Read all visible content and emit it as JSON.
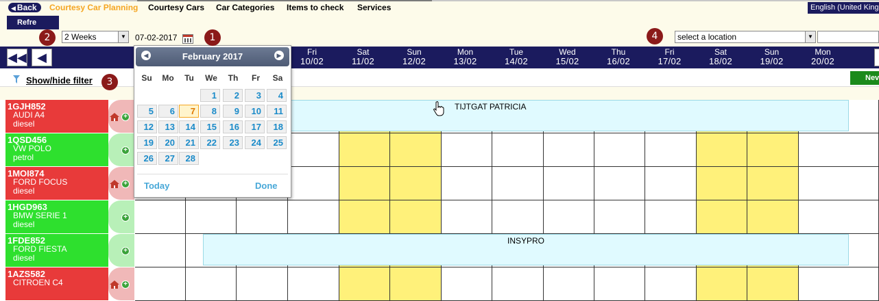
{
  "nav": {
    "back_label": "Back",
    "items": [
      "Courtesy Car Planning",
      "Courtesy Cars",
      "Car Categories",
      "Items to check",
      "Services"
    ],
    "language": "English (United Kingdom)"
  },
  "toolbar": {
    "refresh_label": "Refre",
    "period_value": "2 Weeks",
    "date_value": "07-02-2017",
    "location_placeholder": "select a location"
  },
  "markers": [
    "1",
    "2",
    "3",
    "4"
  ],
  "filter": {
    "label": "Show/hide filter",
    "new_label": "Nev"
  },
  "days": [
    {
      "name": "Fri",
      "date": "10/02"
    },
    {
      "name": "Sat",
      "date": "11/02"
    },
    {
      "name": "Sun",
      "date": "12/02"
    },
    {
      "name": "Mon",
      "date": "13/02"
    },
    {
      "name": "Tue",
      "date": "14/02"
    },
    {
      "name": "Wed",
      "date": "15/02"
    },
    {
      "name": "Thu",
      "date": "16/02"
    },
    {
      "name": "Fri",
      "date": "17/02"
    },
    {
      "name": "Sat",
      "date": "18/02"
    },
    {
      "name": "Sun",
      "date": "19/02"
    },
    {
      "name": "Mon",
      "date": "20/02"
    }
  ],
  "vehicles": [
    {
      "plate": "1GJH852",
      "model": "AUDI A4",
      "fuel": "diesel",
      "status": "red"
    },
    {
      "plate": "1QSD456",
      "model": "VW POLO",
      "fuel": "petrol",
      "status": "green"
    },
    {
      "plate": "1MOI874",
      "model": "FORD FOCUS",
      "fuel": "diesel",
      "status": "red"
    },
    {
      "plate": "1HGD963",
      "model": "BMW SERIE 1",
      "fuel": "diesel",
      "status": "green"
    },
    {
      "plate": "1FDE852",
      "model": "FORD FIESTA",
      "fuel": "diesel",
      "status": "green"
    },
    {
      "plate": "1AZS582",
      "model": "CITROEN C4",
      "fuel": "",
      "status": "red"
    }
  ],
  "bookings": [
    {
      "label": "TIJTGAT PATRICIA"
    },
    {
      "label": "INSYPRO"
    }
  ],
  "datepicker": {
    "month_label": "February 2017",
    "weekdays": [
      "Su",
      "Mo",
      "Tu",
      "We",
      "Th",
      "Fr",
      "Sa"
    ],
    "today_label": "Today",
    "done_label": "Done",
    "selected_day": "7",
    "weeks": [
      [
        "",
        "",
        "",
        "1",
        "2",
        "3",
        "4"
      ],
      [
        "5",
        "6",
        "7",
        "8",
        "9",
        "10",
        "11"
      ],
      [
        "12",
        "13",
        "14",
        "15",
        "16",
        "17",
        "18"
      ],
      [
        "19",
        "20",
        "21",
        "22",
        "23",
        "24",
        "25"
      ],
      [
        "26",
        "27",
        "28",
        "",
        "",
        "",
        ""
      ]
    ]
  },
  "colors": {
    "navy": "#1b1b5e",
    "active_nav": "#f5a623",
    "available": "#2ee02e",
    "unavailable": "#e83a3a",
    "weekend": "#fff17a",
    "booking": "#e0faff",
    "marker": "#8b1a1a"
  }
}
